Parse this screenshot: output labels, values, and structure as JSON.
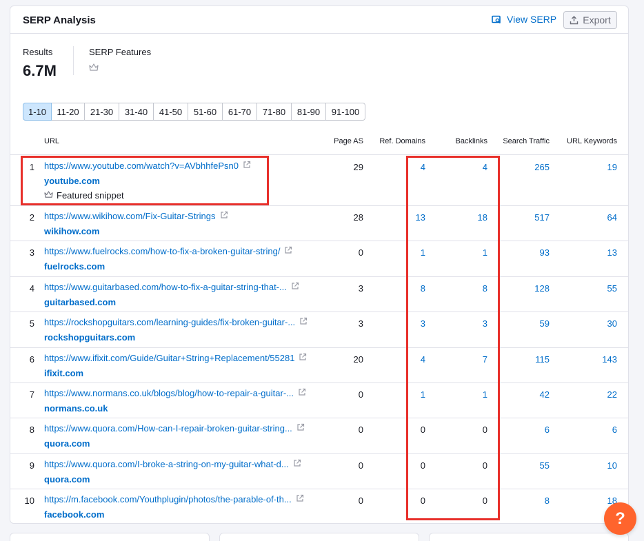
{
  "header": {
    "title": "SERP Analysis",
    "view_serp": "View SERP",
    "export": "Export"
  },
  "stats": {
    "results_label": "Results",
    "results_value": "6.7M",
    "features_label": "SERP Features"
  },
  "pagination": [
    "1-10",
    "11-20",
    "21-30",
    "31-40",
    "41-50",
    "51-60",
    "61-70",
    "71-80",
    "81-90",
    "91-100"
  ],
  "table": {
    "columns": {
      "url": "URL",
      "page_as": "Page AS",
      "ref_domains": "Ref. Domains",
      "backlinks": "Backlinks",
      "search_traffic": "Search Traffic",
      "url_keywords": "URL Keywords"
    },
    "rows": [
      {
        "n": "1",
        "url": "https://www.youtube.com/watch?v=AVbhhfePsn0",
        "domain": "youtube.com",
        "snippet": "Featured snippet",
        "as": "29",
        "rd": "4",
        "bl": "4",
        "st": "265",
        "uk": "19"
      },
      {
        "n": "2",
        "url": "https://www.wikihow.com/Fix-Guitar-Strings",
        "domain": "wikihow.com",
        "as": "28",
        "rd": "13",
        "bl": "18",
        "st": "517",
        "uk": "64"
      },
      {
        "n": "3",
        "url": "https://www.fuelrocks.com/how-to-fix-a-broken-guitar-string/",
        "domain": "fuelrocks.com",
        "as": "0",
        "rd": "1",
        "bl": "1",
        "st": "93",
        "uk": "13"
      },
      {
        "n": "4",
        "url": "https://www.guitarbased.com/how-to-fix-a-guitar-string-that-...",
        "domain": "guitarbased.com",
        "as": "3",
        "rd": "8",
        "bl": "8",
        "st": "128",
        "uk": "55"
      },
      {
        "n": "5",
        "url": "https://rockshopguitars.com/learning-guides/fix-broken-guitar-...",
        "domain": "rockshopguitars.com",
        "as": "3",
        "rd": "3",
        "bl": "3",
        "st": "59",
        "uk": "30"
      },
      {
        "n": "6",
        "url": "https://www.ifixit.com/Guide/Guitar+String+Replacement/55281",
        "domain": "ifixit.com",
        "as": "20",
        "rd": "4",
        "bl": "7",
        "st": "115",
        "uk": "143"
      },
      {
        "n": "7",
        "url": "https://www.normans.co.uk/blogs/blog/how-to-repair-a-guitar-...",
        "domain": "normans.co.uk",
        "as": "0",
        "rd": "1",
        "bl": "1",
        "st": "42",
        "uk": "22"
      },
      {
        "n": "8",
        "url": "https://www.quora.com/How-can-I-repair-broken-guitar-string...",
        "domain": "quora.com",
        "as": "0",
        "rd": "0",
        "bl": "0",
        "st": "6",
        "uk": "6"
      },
      {
        "n": "9",
        "url": "https://www.quora.com/I-broke-a-string-on-my-guitar-what-d...",
        "domain": "quora.com",
        "as": "0",
        "rd": "0",
        "bl": "0",
        "st": "55",
        "uk": "10"
      },
      {
        "n": "10",
        "url": "https://m.facebook.com/Youthplugin/photos/the-parable-of-th...",
        "domain": "facebook.com",
        "as": "0",
        "rd": "0",
        "bl": "0",
        "st": "8",
        "uk": "18"
      }
    ]
  },
  "help_label": "?",
  "colors": {
    "accent": "#006dca",
    "highlight": "#e8302b",
    "help": "#ff642d"
  },
  "icons": [
    "view-serp-icon",
    "export-icon",
    "crown-icon",
    "external-link-icon"
  ]
}
